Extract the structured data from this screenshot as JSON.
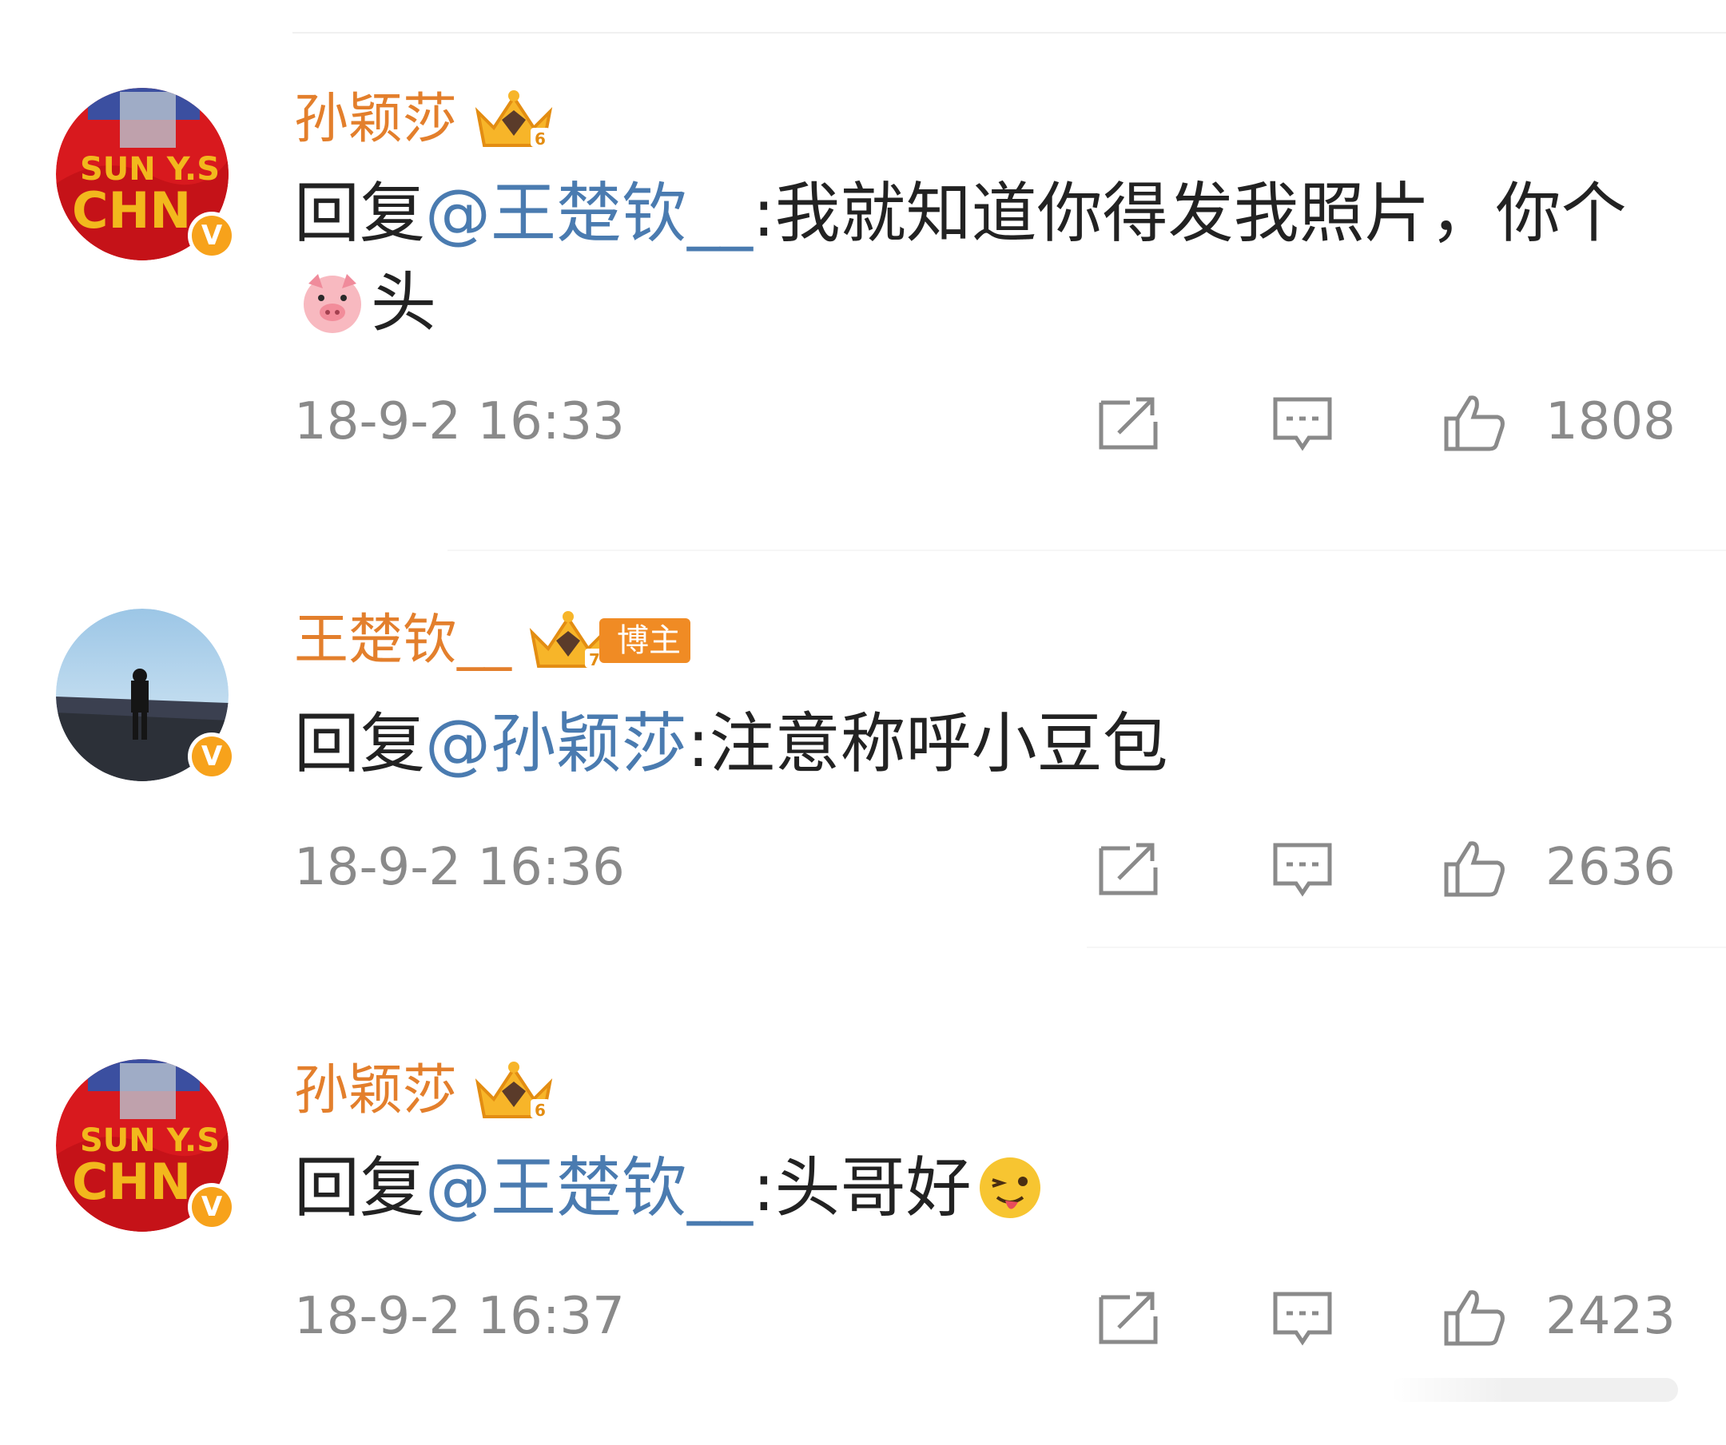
{
  "comments": [
    {
      "username": "孙颖莎",
      "reply_prefix": "回复",
      "mention": "@王楚钦__",
      "text_before_emoji": ":我就知道你得发我照片，你个",
      "emoji": "pig-face",
      "text_after_emoji": "头",
      "timestamp": "18-9-2 16:33",
      "like_count": "1808",
      "badge_label": ""
    },
    {
      "username": "王楚钦__",
      "reply_prefix": "回复",
      "mention": "@孙颖莎",
      "text": ":注意称呼小豆包",
      "timestamp": "18-9-2 16:36",
      "like_count": "2636",
      "badge_label": "博主"
    },
    {
      "username": "孙颖莎",
      "reply_prefix": "回复",
      "mention": "@王楚钦__",
      "text_before_emoji": ":头哥好",
      "emoji": "tongue-wink-face",
      "timestamp": "18-9-2 16:37",
      "like_count": "2423",
      "badge_label": ""
    }
  ],
  "colors": {
    "username": "#e37f2c",
    "mention": "#4a7bb0",
    "text": "#222222",
    "meta": "#8a8a8a",
    "verified": "#f7a21b"
  },
  "icons": [
    "share-icon",
    "comment-icon",
    "like-icon",
    "verified-icon",
    "crown-badge-icon"
  ]
}
